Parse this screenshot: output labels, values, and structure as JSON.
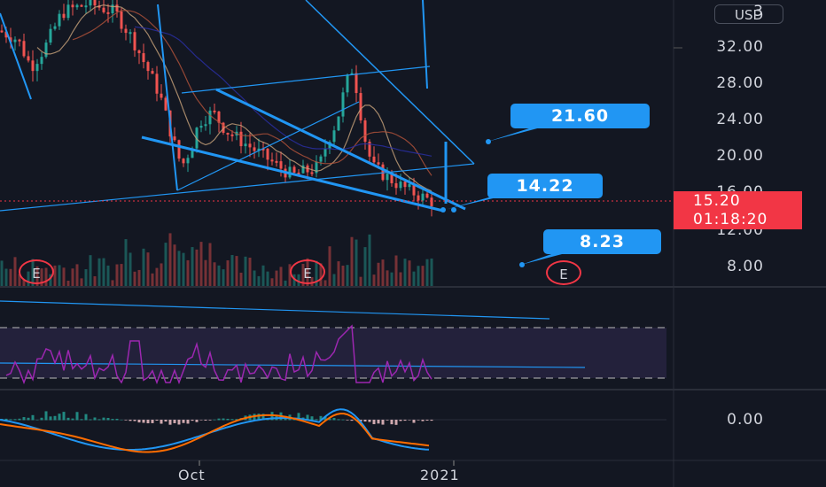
{
  "price_axis": {
    "currency": "USD",
    "labels": [
      "3",
      "32.00",
      "28.00",
      "24.00",
      "20.00",
      "16.00",
      "12.00",
      "8.00"
    ],
    "values": [
      36,
      32,
      28,
      24,
      20,
      16,
      12,
      8
    ]
  },
  "last_price": {
    "value": "15.20",
    "countdown": "01:18:20",
    "color": "#f23645"
  },
  "callouts": [
    {
      "label": "21.60",
      "value": 21.6
    },
    {
      "label": "14.22",
      "value": 14.22
    },
    {
      "label": "8.23",
      "value": 8.23
    }
  ],
  "earnings_markers": [
    {
      "label": "E"
    },
    {
      "label": "E"
    },
    {
      "label": "E"
    }
  ],
  "macd_axis": {
    "label": "0.00"
  },
  "time_axis": {
    "labels": [
      "Oct",
      "2021"
    ]
  },
  "colors": {
    "background": "#131722",
    "up_candle": "#26a69a",
    "down_candle": "#ef5350",
    "drawing_lines": "#2196f3",
    "rsi": "#9c27b0",
    "macd": "#2196f3",
    "signal": "#ff6d00"
  }
}
